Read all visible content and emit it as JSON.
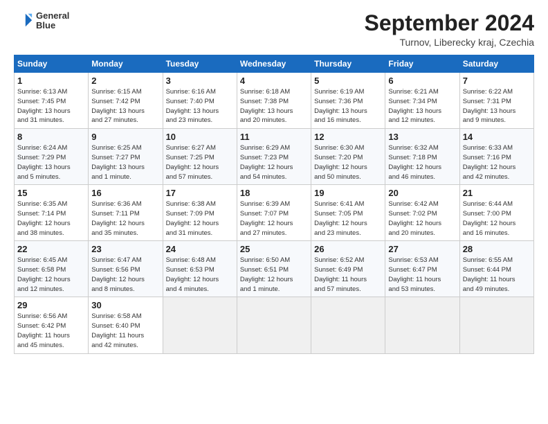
{
  "header": {
    "logo_line1": "General",
    "logo_line2": "Blue",
    "main_title": "September 2024",
    "subtitle": "Turnov, Liberecky kraj, Czechia"
  },
  "calendar": {
    "headers": [
      "Sunday",
      "Monday",
      "Tuesday",
      "Wednesday",
      "Thursday",
      "Friday",
      "Saturday"
    ],
    "weeks": [
      [
        {
          "day": "1",
          "detail": "Sunrise: 6:13 AM\nSunset: 7:45 PM\nDaylight: 13 hours\nand 31 minutes."
        },
        {
          "day": "2",
          "detail": "Sunrise: 6:15 AM\nSunset: 7:42 PM\nDaylight: 13 hours\nand 27 minutes."
        },
        {
          "day": "3",
          "detail": "Sunrise: 6:16 AM\nSunset: 7:40 PM\nDaylight: 13 hours\nand 23 minutes."
        },
        {
          "day": "4",
          "detail": "Sunrise: 6:18 AM\nSunset: 7:38 PM\nDaylight: 13 hours\nand 20 minutes."
        },
        {
          "day": "5",
          "detail": "Sunrise: 6:19 AM\nSunset: 7:36 PM\nDaylight: 13 hours\nand 16 minutes."
        },
        {
          "day": "6",
          "detail": "Sunrise: 6:21 AM\nSunset: 7:34 PM\nDaylight: 13 hours\nand 12 minutes."
        },
        {
          "day": "7",
          "detail": "Sunrise: 6:22 AM\nSunset: 7:31 PM\nDaylight: 13 hours\nand 9 minutes."
        }
      ],
      [
        {
          "day": "8",
          "detail": "Sunrise: 6:24 AM\nSunset: 7:29 PM\nDaylight: 13 hours\nand 5 minutes."
        },
        {
          "day": "9",
          "detail": "Sunrise: 6:25 AM\nSunset: 7:27 PM\nDaylight: 13 hours\nand 1 minute."
        },
        {
          "day": "10",
          "detail": "Sunrise: 6:27 AM\nSunset: 7:25 PM\nDaylight: 12 hours\nand 57 minutes."
        },
        {
          "day": "11",
          "detail": "Sunrise: 6:29 AM\nSunset: 7:23 PM\nDaylight: 12 hours\nand 54 minutes."
        },
        {
          "day": "12",
          "detail": "Sunrise: 6:30 AM\nSunset: 7:20 PM\nDaylight: 12 hours\nand 50 minutes."
        },
        {
          "day": "13",
          "detail": "Sunrise: 6:32 AM\nSunset: 7:18 PM\nDaylight: 12 hours\nand 46 minutes."
        },
        {
          "day": "14",
          "detail": "Sunrise: 6:33 AM\nSunset: 7:16 PM\nDaylight: 12 hours\nand 42 minutes."
        }
      ],
      [
        {
          "day": "15",
          "detail": "Sunrise: 6:35 AM\nSunset: 7:14 PM\nDaylight: 12 hours\nand 38 minutes."
        },
        {
          "day": "16",
          "detail": "Sunrise: 6:36 AM\nSunset: 7:11 PM\nDaylight: 12 hours\nand 35 minutes."
        },
        {
          "day": "17",
          "detail": "Sunrise: 6:38 AM\nSunset: 7:09 PM\nDaylight: 12 hours\nand 31 minutes."
        },
        {
          "day": "18",
          "detail": "Sunrise: 6:39 AM\nSunset: 7:07 PM\nDaylight: 12 hours\nand 27 minutes."
        },
        {
          "day": "19",
          "detail": "Sunrise: 6:41 AM\nSunset: 7:05 PM\nDaylight: 12 hours\nand 23 minutes."
        },
        {
          "day": "20",
          "detail": "Sunrise: 6:42 AM\nSunset: 7:02 PM\nDaylight: 12 hours\nand 20 minutes."
        },
        {
          "day": "21",
          "detail": "Sunrise: 6:44 AM\nSunset: 7:00 PM\nDaylight: 12 hours\nand 16 minutes."
        }
      ],
      [
        {
          "day": "22",
          "detail": "Sunrise: 6:45 AM\nSunset: 6:58 PM\nDaylight: 12 hours\nand 12 minutes."
        },
        {
          "day": "23",
          "detail": "Sunrise: 6:47 AM\nSunset: 6:56 PM\nDaylight: 12 hours\nand 8 minutes."
        },
        {
          "day": "24",
          "detail": "Sunrise: 6:48 AM\nSunset: 6:53 PM\nDaylight: 12 hours\nand 4 minutes."
        },
        {
          "day": "25",
          "detail": "Sunrise: 6:50 AM\nSunset: 6:51 PM\nDaylight: 12 hours\nand 1 minute."
        },
        {
          "day": "26",
          "detail": "Sunrise: 6:52 AM\nSunset: 6:49 PM\nDaylight: 11 hours\nand 57 minutes."
        },
        {
          "day": "27",
          "detail": "Sunrise: 6:53 AM\nSunset: 6:47 PM\nDaylight: 11 hours\nand 53 minutes."
        },
        {
          "day": "28",
          "detail": "Sunrise: 6:55 AM\nSunset: 6:44 PM\nDaylight: 11 hours\nand 49 minutes."
        }
      ],
      [
        {
          "day": "29",
          "detail": "Sunrise: 6:56 AM\nSunset: 6:42 PM\nDaylight: 11 hours\nand 45 minutes."
        },
        {
          "day": "30",
          "detail": "Sunrise: 6:58 AM\nSunset: 6:40 PM\nDaylight: 11 hours\nand 42 minutes."
        },
        {
          "day": "",
          "detail": ""
        },
        {
          "day": "",
          "detail": ""
        },
        {
          "day": "",
          "detail": ""
        },
        {
          "day": "",
          "detail": ""
        },
        {
          "day": "",
          "detail": ""
        }
      ]
    ]
  }
}
